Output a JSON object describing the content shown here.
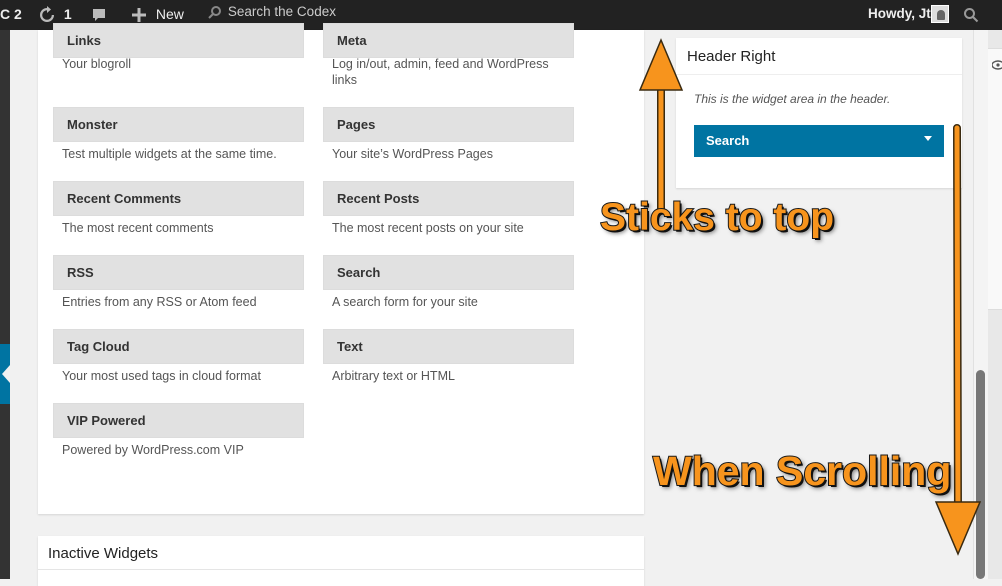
{
  "adminbar": {
    "site_label": "C 2",
    "updates_count": "1",
    "new_label": "New",
    "search_placeholder": "Search the Codex",
    "howdy": "Howdy, Jt"
  },
  "widgets": [
    {
      "title": "Links",
      "desc": "Your blogroll"
    },
    {
      "title": "Meta",
      "desc": "Log in/out, admin, feed and WordPress links"
    },
    {
      "title": "Monster",
      "desc": "Test multiple widgets at the same time."
    },
    {
      "title": "Pages",
      "desc": "Your site’s WordPress Pages"
    },
    {
      "title": "Recent Comments",
      "desc": "The most recent comments"
    },
    {
      "title": "Recent Posts",
      "desc": "The most recent posts on your site"
    },
    {
      "title": "RSS",
      "desc": "Entries from any RSS or Atom feed"
    },
    {
      "title": "Search",
      "desc": "A search form for your site"
    },
    {
      "title": "Tag Cloud",
      "desc": "Your most used tags in cloud format"
    },
    {
      "title": "Text",
      "desc": "Arbitrary text or HTML"
    },
    {
      "title": "VIP Powered",
      "desc": "Powered by WordPress.com VIP"
    }
  ],
  "inactive": {
    "title": "Inactive Widgets"
  },
  "sidebar": {
    "title": "Header Right",
    "description": "This is the widget area in the header.",
    "widget_label": "Search"
  },
  "annotations": {
    "sticks": "Sticks to top",
    "scrolling": "When Scrolling"
  },
  "colors": {
    "accent": "#0074a2",
    "annotation": "#f7941d",
    "adminbar": "#222222"
  }
}
